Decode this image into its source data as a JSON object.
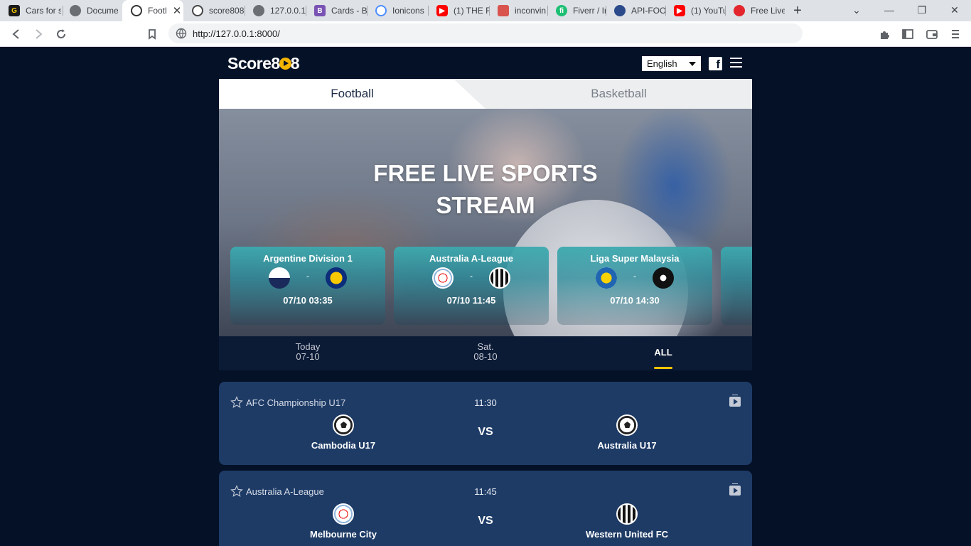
{
  "browser": {
    "tabs": [
      {
        "title": "Cars for s",
        "icon": "carsforsale-icon",
        "color": "#1a1a1a"
      },
      {
        "title": "Docume",
        "icon": "globe-icon",
        "color": "#5f6368"
      },
      {
        "title": "Footl",
        "icon": "soccer-ball-icon",
        "color": "#333333",
        "active": true
      },
      {
        "title": "score808",
        "icon": "soccer-ball-icon",
        "color": "#333333"
      },
      {
        "title": "127.0.0.1",
        "icon": "globe-icon",
        "color": "#5f6368"
      },
      {
        "title": "Cards - B",
        "icon": "bootstrap-icon",
        "color": "#7952b3"
      },
      {
        "title": "Ionicons",
        "icon": "ionicons-icon",
        "color": "#4d8dff"
      },
      {
        "title": "(1) THE F",
        "icon": "youtube-icon",
        "color": "#ff0000"
      },
      {
        "title": "inconvin",
        "icon": "shield-icon",
        "color": "#d9534f"
      },
      {
        "title": "Fiverr / Ir",
        "icon": "fiverr-icon",
        "color": "#1dbf73"
      },
      {
        "title": "API-FOO",
        "icon": "api-icon",
        "color": "#2b4a8b"
      },
      {
        "title": "(1) YouTu",
        "icon": "youtube-icon",
        "color": "#ff0000"
      },
      {
        "title": "Free Live",
        "icon": "soccer-ball-icon",
        "color": "#e3262e"
      }
    ],
    "url": "http://127.0.0.1:8000/"
  },
  "header": {
    "logo_text": "Score8",
    "logo_suffix": "8",
    "language": "English",
    "facebook": "f"
  },
  "sport_tabs": {
    "football": "Football",
    "basketball": "Basketball"
  },
  "hero": {
    "title_line1": "FREE LIVE SPORTS",
    "title_line2": "STREAM"
  },
  "featured": [
    {
      "league": "Argentine Division 1",
      "dash": "-",
      "time": "07/10 03:35"
    },
    {
      "league": "Australia A-League",
      "dash": "-",
      "time": "07/10 11:45"
    },
    {
      "league": "Liga Super Malaysia",
      "dash": "-",
      "time": "07/10 14:30"
    }
  ],
  "date_tabs": [
    {
      "line1": "Today",
      "line2": "07-10"
    },
    {
      "line1": "Sat.",
      "line2": "08-10"
    },
    {
      "line1": "ALL",
      "line2": ""
    }
  ],
  "matches": [
    {
      "league": "AFC Championship U17",
      "time": "11:30",
      "home": "Cambodia U17",
      "away": "Australia U17",
      "vs": "VS"
    },
    {
      "league": "Australia A-League",
      "time": "11:45",
      "home": "Melbourne City",
      "away": "Western United FC",
      "vs": "VS"
    }
  ],
  "colors": {
    "page_bg": "#041127",
    "card_bg": "#1e3b66",
    "accent": "#f5c400",
    "teal": "#3caaaf"
  }
}
